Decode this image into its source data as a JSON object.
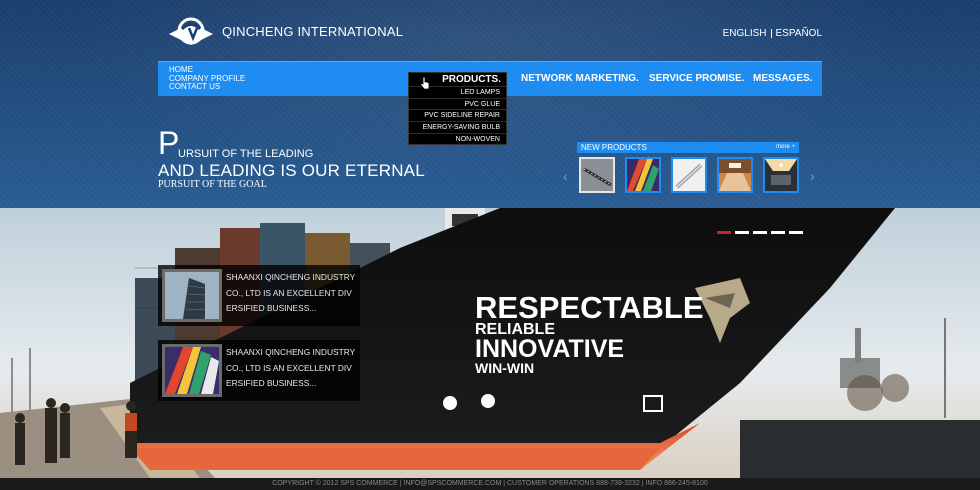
{
  "header": {
    "logo_text": "QINCHENG INTERNATIONAL",
    "lang_en": "ENGLISH",
    "lang_es": "ESPAÑOL"
  },
  "nav": {
    "left_links": [
      "HOME",
      "COMPANY PROFILE",
      "CONTACT US"
    ],
    "products": "PRODUCTS.",
    "network_marketing": "NETWORK MARKETING.",
    "service_promise": "SERVICE PROMISE.",
    "messages": "MESSAGES."
  },
  "products_menu": [
    "LED LAMPS",
    "PVC GLUE",
    "PVC SIDELINE REPAIR",
    "ENERGY-SAVING BULB",
    "NON-WOVEN"
  ],
  "slogan": {
    "big_letter": "P",
    "line1": "URSUIT OF THE LEADING",
    "line2": "AND LEADING IS OUR ETERNAL",
    "line3": "PURSUIT OF THE GOAL"
  },
  "new_products": {
    "title": "NEW PRODUCTS",
    "more": "more +",
    "selected_index": 0
  },
  "hero": {
    "slides": 5,
    "active_slide": 0,
    "tagline": [
      "RESPECTABLE",
      "RELIABLE",
      "INNOVATIVE",
      "WIN-WIN"
    ],
    "cards": [
      {
        "lines": [
          "SHAANXI QINCHENG INDUSTRY",
          "CO., LTD IS AN EXCELLENT DIV",
          "ERSIFIED BUSINESS..."
        ]
      },
      {
        "lines": [
          "SHAANXI QINCHENG INDUSTRY",
          "CO., LTD IS AN EXCELLENT DIV",
          "ERSIFIED BUSINESS..."
        ]
      }
    ]
  },
  "footer": {
    "text": "COPYRIGHT © 2012 SPS COMMERCE | INFO@SPSCOMMERCE.COM | CUSTOMER OPERATIONS 888-739-3232 | INFO 866-245-8100"
  },
  "colors": {
    "nav_blue": "#1e8cf0",
    "header_bg": "#1b3f6e",
    "active_dot": "#c9231f"
  }
}
